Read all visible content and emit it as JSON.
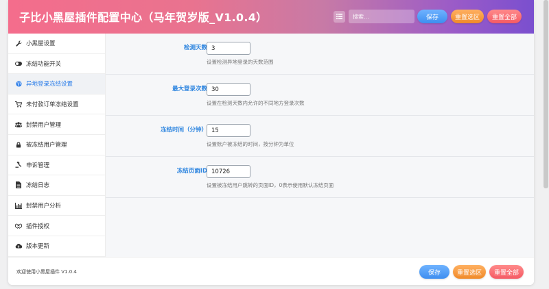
{
  "header": {
    "title": "子比小黑屋插件配置中心（马年贺岁版_V1.0.4）",
    "search_placeholder": "搜索...",
    "save_label": "保存",
    "reset_section_label": "重置选区",
    "reset_all_label": "重置全部"
  },
  "sidebar": {
    "items": [
      {
        "label": "小黑屋设置",
        "icon": "wrench-icon"
      },
      {
        "label": "冻结功能开关",
        "icon": "toggle-icon"
      },
      {
        "label": "异地登录冻结设置",
        "icon": "globe-icon"
      },
      {
        "label": "未付款订单冻结设置",
        "icon": "cart-icon"
      },
      {
        "label": "封禁用户管理",
        "icon": "users-icon"
      },
      {
        "label": "被冻结用户管理",
        "icon": "lock-icon"
      },
      {
        "label": "申诉管理",
        "icon": "gavel-icon"
      },
      {
        "label": "冻结日志",
        "icon": "file-icon"
      },
      {
        "label": "封禁用户分析",
        "icon": "bar-chart-icon"
      },
      {
        "label": "插件授权",
        "icon": "handshake-icon"
      },
      {
        "label": "版本更新",
        "icon": "cloud-download-icon"
      }
    ],
    "active_index": 2
  },
  "fields": [
    {
      "label": "检测天数",
      "value": "3",
      "desc": "设置检测异地登录的天数范围"
    },
    {
      "label": "最大登录次数",
      "value": "30",
      "desc": "设置在检测天数内允许的不同地方登录次数"
    },
    {
      "label": "冻结时间（分钟）",
      "value": "15",
      "desc": "设置账户被冻结的时间，按分钟为单位"
    },
    {
      "label": "冻结页面ID",
      "value": "10726",
      "desc": "设置被冻结用户跳转的页面ID，0表示使用默认冻结页面"
    }
  ],
  "footer": {
    "text": "欢迎使用小黑屋插件 V1.0.4",
    "save_label": "保存",
    "reset_section_label": "重置选区",
    "reset_all_label": "重置全部"
  },
  "colors": {
    "accent": "#2f86e0",
    "header_start": "#f46d8c",
    "header_end": "#7a4fcf"
  }
}
